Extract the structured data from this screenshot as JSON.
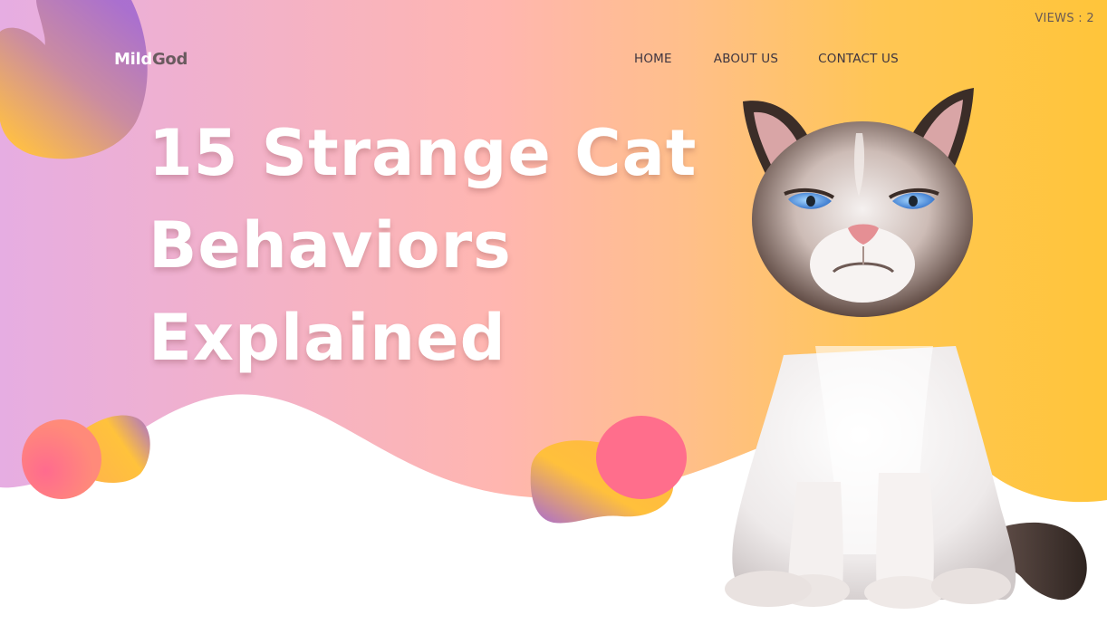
{
  "header": {
    "views_text": "VIEWS : 2",
    "logo": {
      "part1": "Mild",
      "part2": "God"
    },
    "nav": {
      "home": "HOME",
      "about": "ABOUT US",
      "contact": "CONTACT US"
    }
  },
  "hero": {
    "title_lines": [
      "15 Strange Cat",
      "Behaviors",
      "Explained"
    ]
  },
  "colors": {
    "gradient_left": "#e8aee0",
    "gradient_mid": "#ffb8ab",
    "gradient_right": "#ffc43f",
    "blob_purple": "#a56dd0",
    "blob_pink": "#ff6f8e",
    "blob_yellow": "#ffc53a"
  },
  "images": {
    "hero_cat": "grumpy-cat-illustration"
  }
}
